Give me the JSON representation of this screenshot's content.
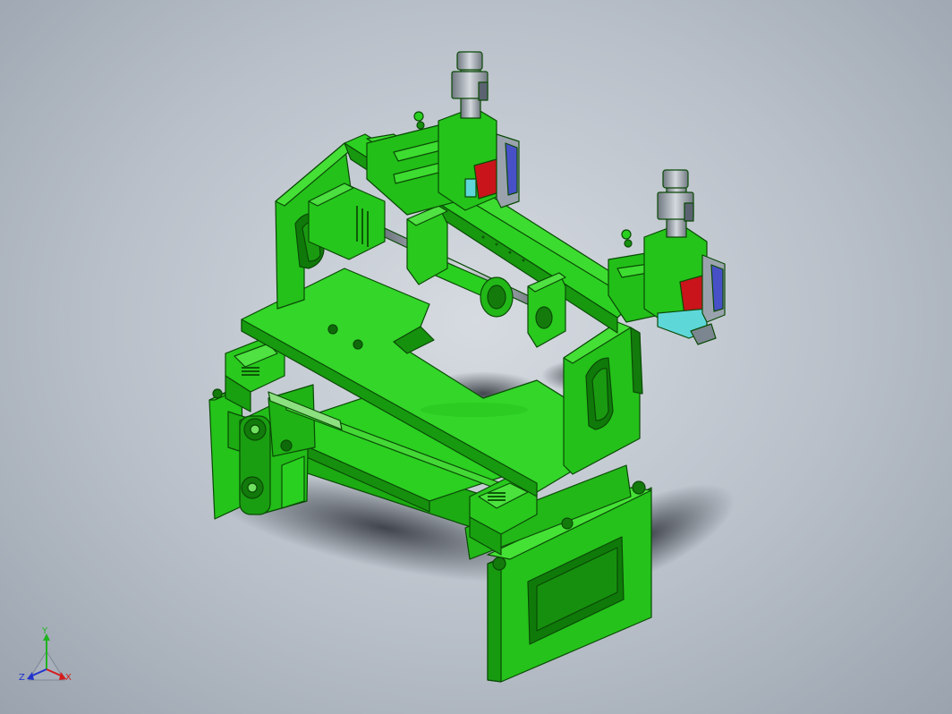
{
  "viewport": {
    "background_top": "#d6dbe1",
    "background_edge": "#9aa3ae"
  },
  "model": {
    "body_color": "#1fbf14",
    "edge_color": "#0a4a06",
    "accent_red": "#c8141a",
    "accent_cyan": "#5ed7d9",
    "metal_color": "#9aa3ad"
  },
  "triad": {
    "x_label": "X",
    "y_label": "Y",
    "z_label": "Z",
    "x_color": "#d41c1c",
    "y_color": "#1fb31f",
    "z_color": "#2233cc"
  }
}
